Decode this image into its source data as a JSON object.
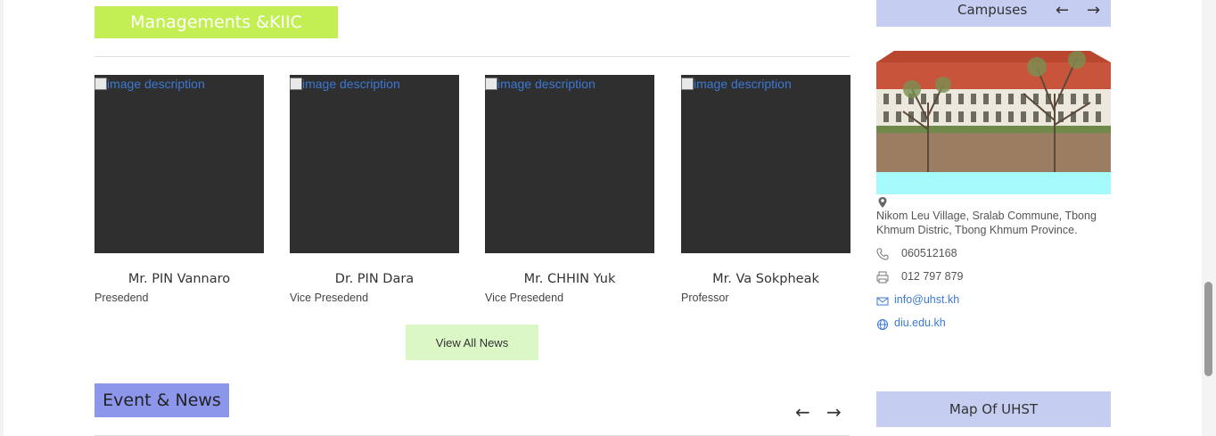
{
  "management": {
    "title": "Managements &KIIC",
    "image_alt": "image description",
    "members": [
      {
        "name": "Mr. PIN Vannaro",
        "role": "Presedend"
      },
      {
        "name": "Dr. PIN Dara",
        "role": "Vice Presedend"
      },
      {
        "name": "Mr. CHHIN Yuk",
        "role": "Vice Presedend"
      },
      {
        "name": "Mr. Va Sokpheak",
        "role": "Professor"
      }
    ],
    "view_all_label": "View All News"
  },
  "events": {
    "title": "Event & News",
    "prev_arrow": "←",
    "next_arrow": "→"
  },
  "campuses": {
    "title": "Campuses",
    "prev_arrow": "←",
    "next_arrow": "→",
    "address": "Nikom Leu Village, Sralab Commune, Tbong Khmum Distric, Tbong Khmum Province.",
    "phone": "060512168",
    "fax": "012 797 879",
    "email": "info@uhst.kh",
    "website": "diu.edu.kh"
  },
  "map": {
    "title": "Map Of UHST"
  },
  "icons": {
    "location": "map-pin-icon",
    "phone": "phone-icon",
    "fax": "fax-icon",
    "email": "mail-icon",
    "website": "globe-icon"
  },
  "colors": {
    "management_header": "#c3ef55",
    "event_header": "#8c96ea",
    "sidebar_header": "#c5cdf0",
    "view_all_bg": "#dcf7c6",
    "link": "#3b78d4"
  }
}
